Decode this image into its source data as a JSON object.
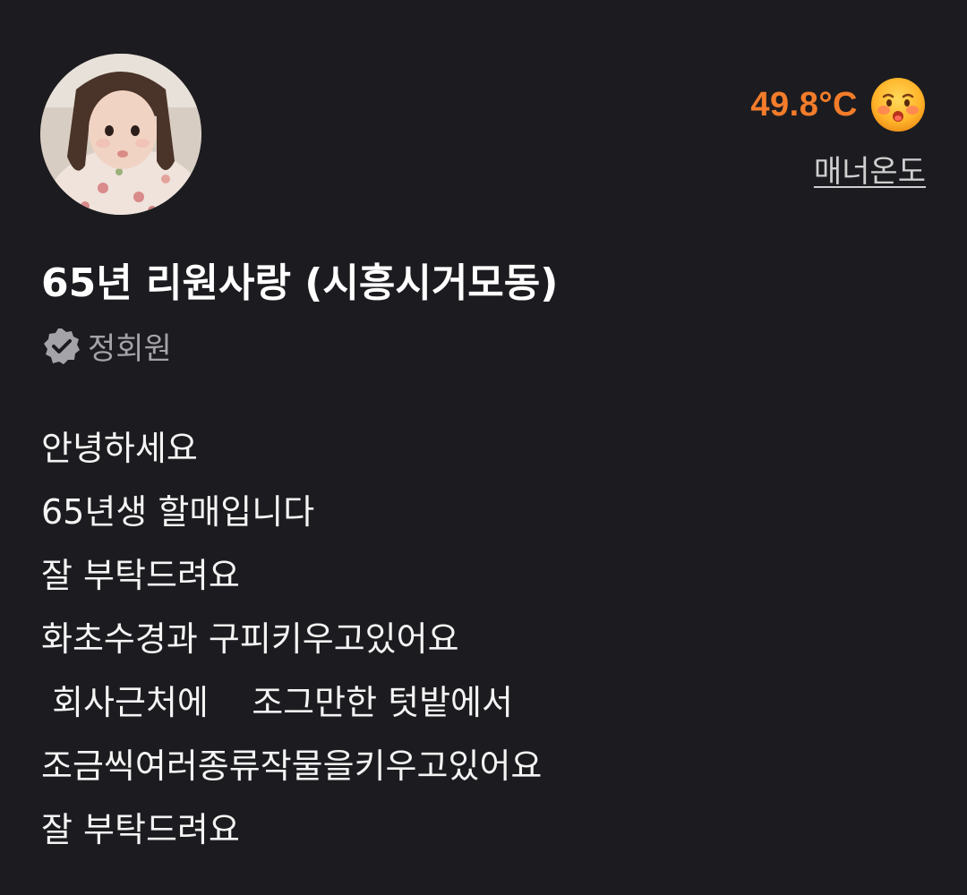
{
  "profile": {
    "manner_temperature": "49.8°C",
    "manner_temperature_label": "매너온도",
    "temperature_emoji": "hot-face-emoji",
    "nickname": "65년 리원사랑 (시흥시거모동)",
    "badge_icon": "verified-check-icon",
    "badge_label": "정회원"
  },
  "bio": {
    "lines": [
      "안녕하세요",
      "65년생 할매입니다",
      "잘 부탁드려요",
      "화초수경과 구피키우고있어요",
      " 회사근처에    조그만한 텃밭에서",
      "조금씩여러종류작물을키우고있어요",
      "잘 부탁드려요"
    ]
  },
  "colors": {
    "background": "#1c1c20",
    "temperature": "#f37c2a",
    "badge": "#a4a4a8"
  }
}
